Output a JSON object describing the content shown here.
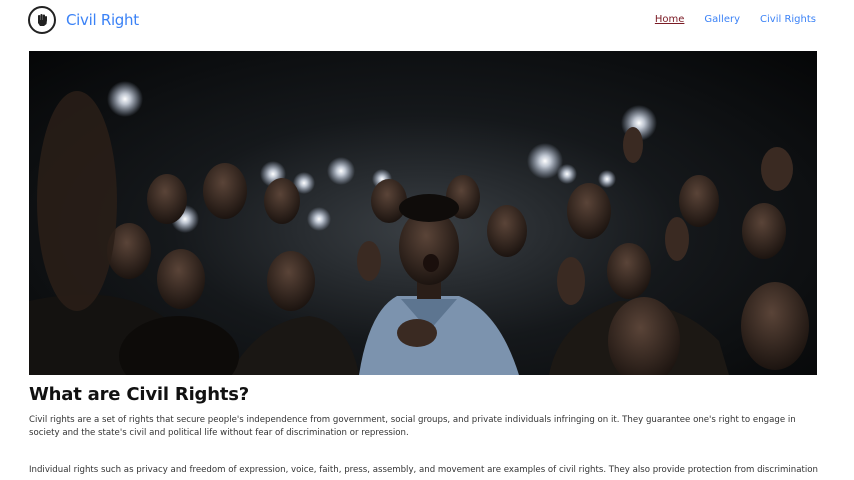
{
  "navbar": {
    "brand": "Civil Right",
    "logo_icon": "raised-fist-icon",
    "links": [
      {
        "label": "Home",
        "active": true
      },
      {
        "label": "Gallery",
        "active": false
      },
      {
        "label": "Civil Rights",
        "active": false
      }
    ],
    "link_color": "#3b82f6",
    "active_color": "#7a1a24"
  },
  "hero": {
    "image": "protest-crowd-phone-lights-photo"
  },
  "main": {
    "heading": "What are Civil Rights?",
    "paragraphs": [
      "Civil rights are a set of rights that secure people's independence from government, social groups, and private individuals infringing on it. They guarantee one's right to engage in society and the state's civil and political life without fear of discrimination or repression.",
      "Individual rights such as privacy and freedom of expression, voice, faith, press, assembly, and movement are examples of civil rights. They also provide protection from discrimination"
    ]
  }
}
